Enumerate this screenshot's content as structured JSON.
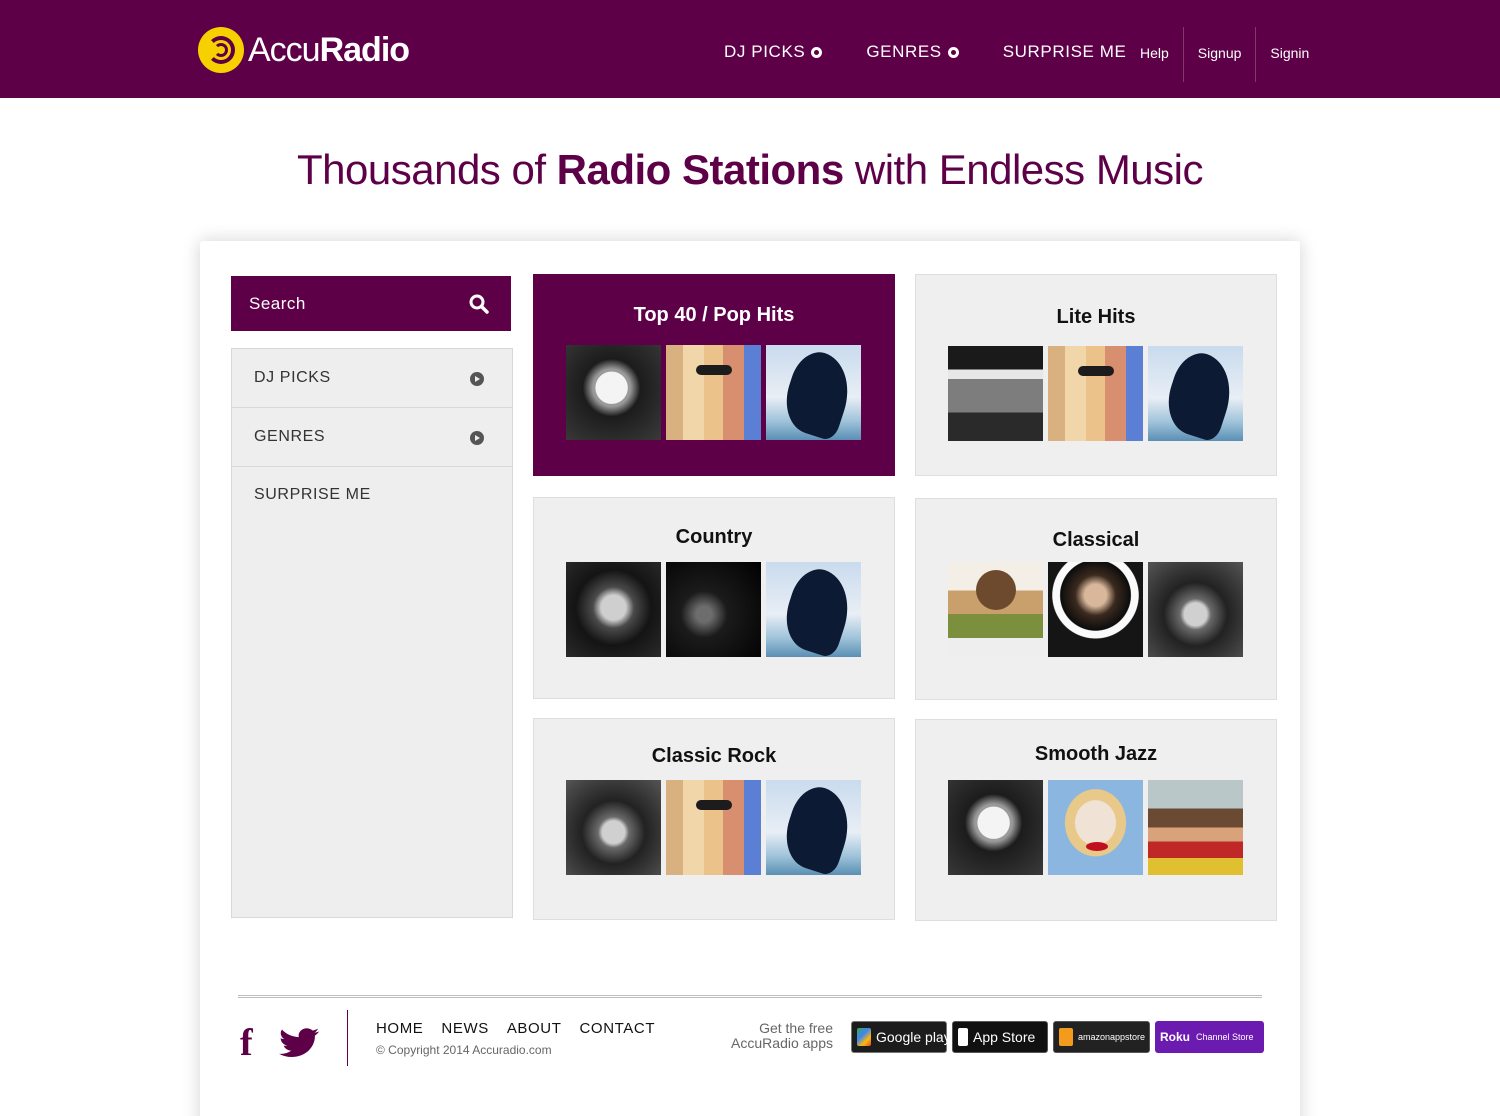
{
  "header": {
    "logo_light": "Accu",
    "logo_bold": "Radio",
    "nav": [
      "DJ PICKS",
      "GENRES",
      "SURPRISE ME"
    ],
    "account_links": [
      "Help",
      "Signup",
      "Signin"
    ]
  },
  "hero": {
    "prefix": "Thousands of ",
    "highlight": "Radio Stations",
    "suffix": " with Endless Music"
  },
  "search": {
    "placeholder": "Search"
  },
  "sidebar": {
    "items": [
      {
        "label": "DJ PICKS"
      },
      {
        "label": "GENRES"
      },
      {
        "label": "SURPRISE ME"
      }
    ]
  },
  "stations": [
    {
      "title": "Top 40 / Pop Hits",
      "active": true
    },
    {
      "title": "Lite Hits",
      "active": false
    },
    {
      "title": "Country",
      "active": false
    },
    {
      "title": "Classical",
      "active": false
    },
    {
      "title": "Classic Rock",
      "active": false
    },
    {
      "title": "Smooth Jazz",
      "active": false
    }
  ],
  "footer": {
    "links": [
      "HOME",
      "NEWS",
      "ABOUT",
      "CONTACT"
    ],
    "copyright": "© Copyright 2014 Accuradio.com",
    "apps_line1": "Get the free",
    "apps_line2": "AccuRadio apps",
    "badges": [
      "Google play",
      "App Store",
      "amazonappstore",
      "Channel Store"
    ]
  },
  "colors": {
    "brand": "#5e0047",
    "logo_yellow": "#f7d000"
  }
}
